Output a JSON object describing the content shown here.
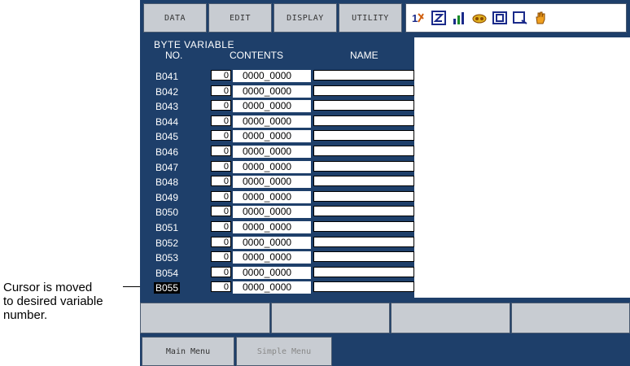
{
  "annotation": {
    "lines": [
      "Cursor is moved",
      "to desired variable",
      "number."
    ]
  },
  "menu": {
    "items": [
      {
        "label": "DATA"
      },
      {
        "label": "EDIT"
      },
      {
        "label": "DISPLAY"
      },
      {
        "label": "UTILITY"
      }
    ],
    "status_icons": [
      "coord-mode-icon",
      "teach-mode-icon",
      "signal-icon",
      "speed-icon",
      "storage-icon",
      "page-icon",
      "hand-icon"
    ]
  },
  "variable_panel": {
    "title": "BYTE VARIABLE",
    "col_no": "NO.",
    "col_contents": "CONTENTS",
    "col_name": "NAME",
    "rows": [
      {
        "no": "B041",
        "dec": "0",
        "bin": "0000_0000"
      },
      {
        "no": "B042",
        "dec": "0",
        "bin": "0000_0000"
      },
      {
        "no": "B043",
        "dec": "0",
        "bin": "0000_0000"
      },
      {
        "no": "B044",
        "dec": "0",
        "bin": "0000_0000"
      },
      {
        "no": "B045",
        "dec": "0",
        "bin": "0000_0000"
      },
      {
        "no": "B046",
        "dec": "0",
        "bin": "0000_0000"
      },
      {
        "no": "B047",
        "dec": "0",
        "bin": "0000_0000"
      },
      {
        "no": "B048",
        "dec": "0",
        "bin": "0000_0000"
      },
      {
        "no": "B049",
        "dec": "0",
        "bin": "0000_0000"
      },
      {
        "no": "B050",
        "dec": "0",
        "bin": "0000_0000"
      },
      {
        "no": "B051",
        "dec": "0",
        "bin": "0000_0000"
      },
      {
        "no": "B052",
        "dec": "0",
        "bin": "0000_0000"
      },
      {
        "no": "B053",
        "dec": "0",
        "bin": "0000_0000"
      },
      {
        "no": "B054",
        "dec": "0",
        "bin": "0000_0000"
      },
      {
        "no": "B055",
        "dec": "0",
        "bin": "0000_0000",
        "selected": true
      }
    ]
  },
  "bottom": {
    "main_menu": "Main Menu",
    "simple_menu": "Simple Menu"
  },
  "colors": {
    "screen_bg": "#1e3f6a",
    "button_bg": "#c8ccd2"
  }
}
